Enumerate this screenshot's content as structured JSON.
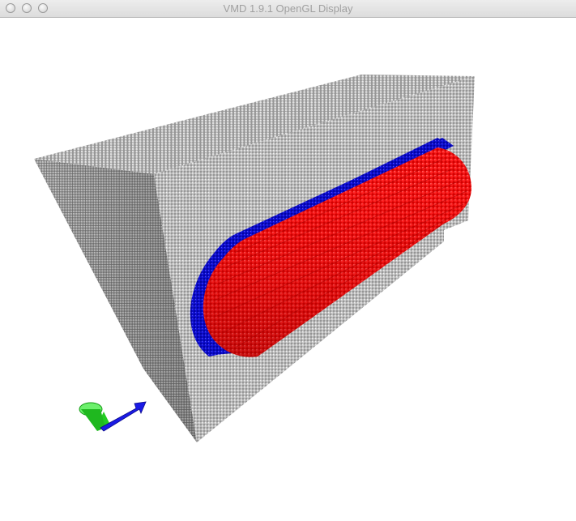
{
  "window": {
    "title": "VMD 1.9.1 OpenGL Display",
    "controls": {
      "close": "close-button",
      "minimize": "minimize-button",
      "zoom": "zoom-button"
    }
  },
  "scene": {
    "background_color": "#ffffff",
    "box_color": "#bdbdbd",
    "shell_color": "#0000cc",
    "core_color": "#ee0000",
    "axes": {
      "x_color": "#1a1ae6",
      "y_color": "#22cc22"
    }
  }
}
